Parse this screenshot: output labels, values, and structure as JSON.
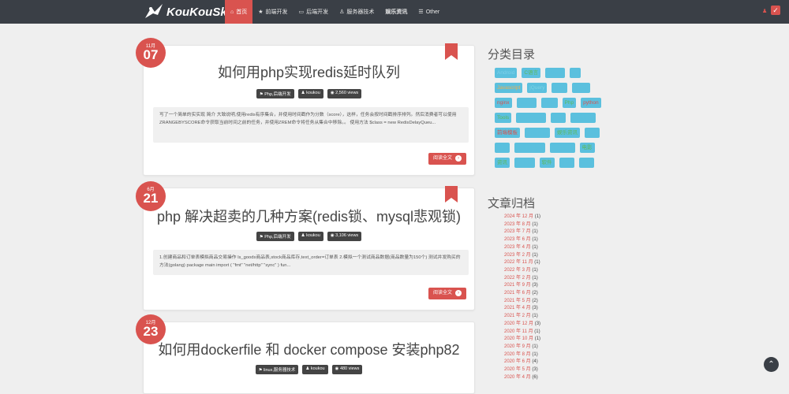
{
  "header": {
    "logo": "KouKouSky",
    "nav": [
      {
        "icon": "⌂",
        "label": "首页",
        "active": true
      },
      {
        "icon": "★",
        "label": "前端开发"
      },
      {
        "icon": "▭",
        "label": "后端开发"
      },
      {
        "icon": "♙",
        "label": "服务器技术"
      },
      {
        "icon": "",
        "label": "娱乐资讯",
        "bold": true
      },
      {
        "icon": "☰",
        "label": "Other"
      }
    ]
  },
  "posts": [
    {
      "month": "11月",
      "day": "07",
      "title": "如何用php实现redis延时队列",
      "category": "Php,后端开发",
      "author": "koukou",
      "views": "2,560 views",
      "excerpt": "写了一个简单的实实现 简介 大致说明,使用redis有序集合，并使用时间戳作为分数（score），这样，任务会按时间戳排序排列。然后消费者可以使用ZRANGEBYSCORE命令获取当前时间之前的任务，并使用ZREM命令将任务从集合中移除。。 使用方法 $class = new RedisDelayQueu...",
      "readmore": "阅读全文"
    },
    {
      "month": "6月",
      "day": "21",
      "title": "php 解决超卖的几种方案(redis锁、mysql悲观锁)",
      "category": "Php,后端开发",
      "author": "koukou",
      "views": "3,106 views",
      "excerpt": "1.创建商品和订单表模拟商品交易操作 ls_goods商品表,stock商品库存,text_order=订单表 2.模拟一个测试商品数据(商品数量为150个) 测试并发购买的方法(golang) package main import ( \"fmt\" \"net/http\" \"sync\" ) fun...",
      "readmore": "阅读全文"
    },
    {
      "month": "12月",
      "day": "23",
      "title": "如何用dockerfile 和 docker compose 安装php82",
      "category": "linux,服务器技术",
      "author": "koukou",
      "views": "480 views"
    }
  ],
  "sidebar": {
    "categories_title": "分类目录",
    "categories": [
      [
        {
          "label": "Android",
          "color": "#7ed0e8"
        },
        {
          "label": "C语言",
          "color": "#5cb85c"
        },
        {
          "label": "Cocos",
          "color": "#5bc0de"
        },
        {
          "label": "Go",
          "color": "#5bc0de"
        }
      ],
      [
        {
          "label": "Javascript",
          "color": "#f0ad4e"
        },
        {
          "label": "jQuery",
          "color": "#7fd3e3"
        },
        {
          "label": "linux",
          "color": "#5bc0de"
        },
        {
          "label": "Mysql",
          "color": "#5bc0de"
        }
      ],
      [
        {
          "label": "nginx",
          "color": "#d9534f"
        },
        {
          "label": "nodejs",
          "color": "#5bc0de"
        },
        {
          "label": "other",
          "color": "#5bc0de"
        },
        {
          "label": "Php",
          "color": "#5cb85c"
        },
        {
          "label": "python",
          "color": "#d9534f"
        }
      ],
      [
        {
          "label": "Tools",
          "color": "#5cb85c"
        },
        {
          "label": "Wordpress",
          "color": "#5bc0de"
        },
        {
          "label": "产品",
          "color": "#5bc0de"
        },
        {
          "label": "前端开发",
          "color": "#5bc0de"
        }
      ],
      [
        {
          "label": "前端模板",
          "color": "#d9534f"
        },
        {
          "label": "后端开发",
          "color": "#5bc0de"
        },
        {
          "label": "娱乐资讯",
          "color": "#5cb85c"
        },
        {
          "label": "心情",
          "color": "#5bc0de"
        }
      ],
      [
        {
          "label": "摄影",
          "color": "#5bc0de"
        },
        {
          "label": "服务器技术",
          "color": "#5bc0de"
        },
        {
          "label": "生活随记",
          "color": "#5bc0de"
        },
        {
          "label": "电影",
          "color": "#5cb85c"
        }
      ],
      [
        {
          "label": "资讯",
          "color": "#5cb85c"
        },
        {
          "label": "轻小说",
          "color": "#5bc0de"
        },
        {
          "label": "软件",
          "color": "#5cb85c"
        },
        {
          "label": "闲谈",
          "color": "#5bc0de"
        },
        {
          "label": "音乐",
          "color": "#5bc0de"
        }
      ]
    ],
    "archive_title": "文章归档",
    "archives": [
      {
        "label": "2024 年 12 月",
        "count": "(1)"
      },
      {
        "label": "2023 年 8 月",
        "count": "(1)"
      },
      {
        "label": "2023 年 7 月",
        "count": "(1)"
      },
      {
        "label": "2023 年 6 月",
        "count": "(1)"
      },
      {
        "label": "2023 年 4 月",
        "count": "(1)"
      },
      {
        "label": "2023 年 2 月",
        "count": "(1)"
      },
      {
        "label": "2022 年 11 月",
        "count": "(1)"
      },
      {
        "label": "2022 年 3 月",
        "count": "(1)"
      },
      {
        "label": "2022 年 2 月",
        "count": "(1)"
      },
      {
        "label": "2021 年 9 月",
        "count": "(3)"
      },
      {
        "label": "2021 年 6 月",
        "count": "(2)"
      },
      {
        "label": "2021 年 5 月",
        "count": "(2)"
      },
      {
        "label": "2021 年 4 月",
        "count": "(3)"
      },
      {
        "label": "2021 年 2 月",
        "count": "(1)"
      },
      {
        "label": "2020 年 12 月",
        "count": "(3)"
      },
      {
        "label": "2020 年 11 月",
        "count": "(1)"
      },
      {
        "label": "2020 年 10 月",
        "count": "(1)"
      },
      {
        "label": "2020 年 9 月",
        "count": "(1)"
      },
      {
        "label": "2020 年 8 月",
        "count": "(1)"
      },
      {
        "label": "2020 年 6 月",
        "count": "(4)"
      },
      {
        "label": "2020 年 5 月",
        "count": "(3)"
      },
      {
        "label": "2020 年 4 月",
        "count": "(6)"
      }
    ]
  }
}
